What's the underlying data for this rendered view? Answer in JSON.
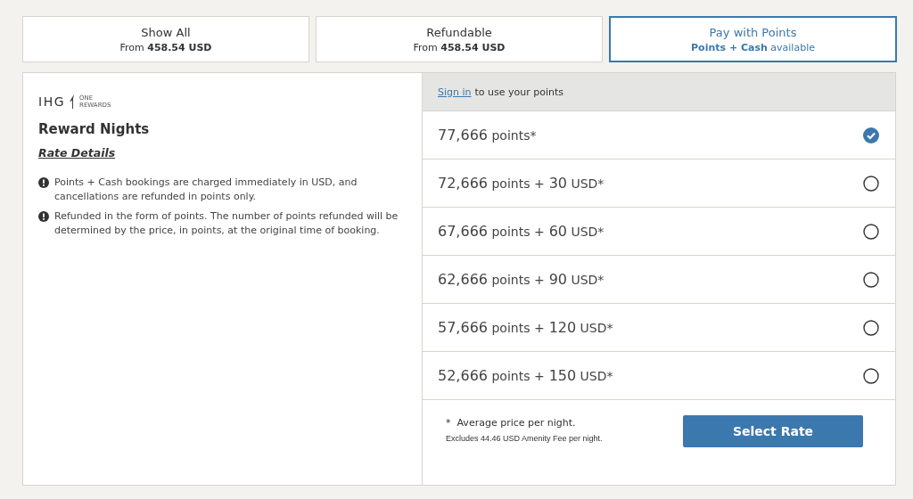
{
  "tabs": [
    {
      "title": "Show All",
      "subtitle": "From **458.54 USD**",
      "selected": false
    },
    {
      "title": "Refundable",
      "subtitle": "From **458.54 USD**",
      "selected": false
    },
    {
      "title": "Pay with Points",
      "subtitle": "**Points + Cash** available",
      "selected": true
    }
  ],
  "rate": {
    "logo": {
      "brand": "IHG",
      "program": [
        "ONE",
        "REWARDS"
      ]
    },
    "title": "Reward Nights",
    "details_link": "Rate Details",
    "notes": [
      "Points + Cash bookings are charged immediately in USD, and cancellations are refunded in points only.",
      "Refunded in the form of points. The number of points refunded will be determined by the price, in points, at the original time of booking."
    ]
  },
  "points": {
    "sign_in_link": "Sign in",
    "sign_in_text": "to use your points",
    "options": [
      {
        "points": "77,666",
        "points_label": "points*",
        "selected": true
      },
      {
        "points": "72,666",
        "points_label": "points +",
        "cash": "30",
        "cash_label": "USD*",
        "selected": false
      },
      {
        "points": "67,666",
        "points_label": "points +",
        "cash": "60",
        "cash_label": "USD*",
        "selected": false
      },
      {
        "points": "62,666",
        "points_label": "points +",
        "cash": "90",
        "cash_label": "USD*",
        "selected": false
      },
      {
        "points": "57,666",
        "points_label": "points +",
        "cash": "120",
        "cash_label": "USD*",
        "selected": false
      },
      {
        "points": "52,666",
        "points_label": "points +",
        "cash": "150",
        "cash_label": "USD*",
        "selected": false
      }
    ],
    "footnote_mark": "*",
    "footnote": "Average price per night.",
    "fee_note": "Excludes 44.46 USD Amenity Fee per night.",
    "button": "Select Rate"
  }
}
